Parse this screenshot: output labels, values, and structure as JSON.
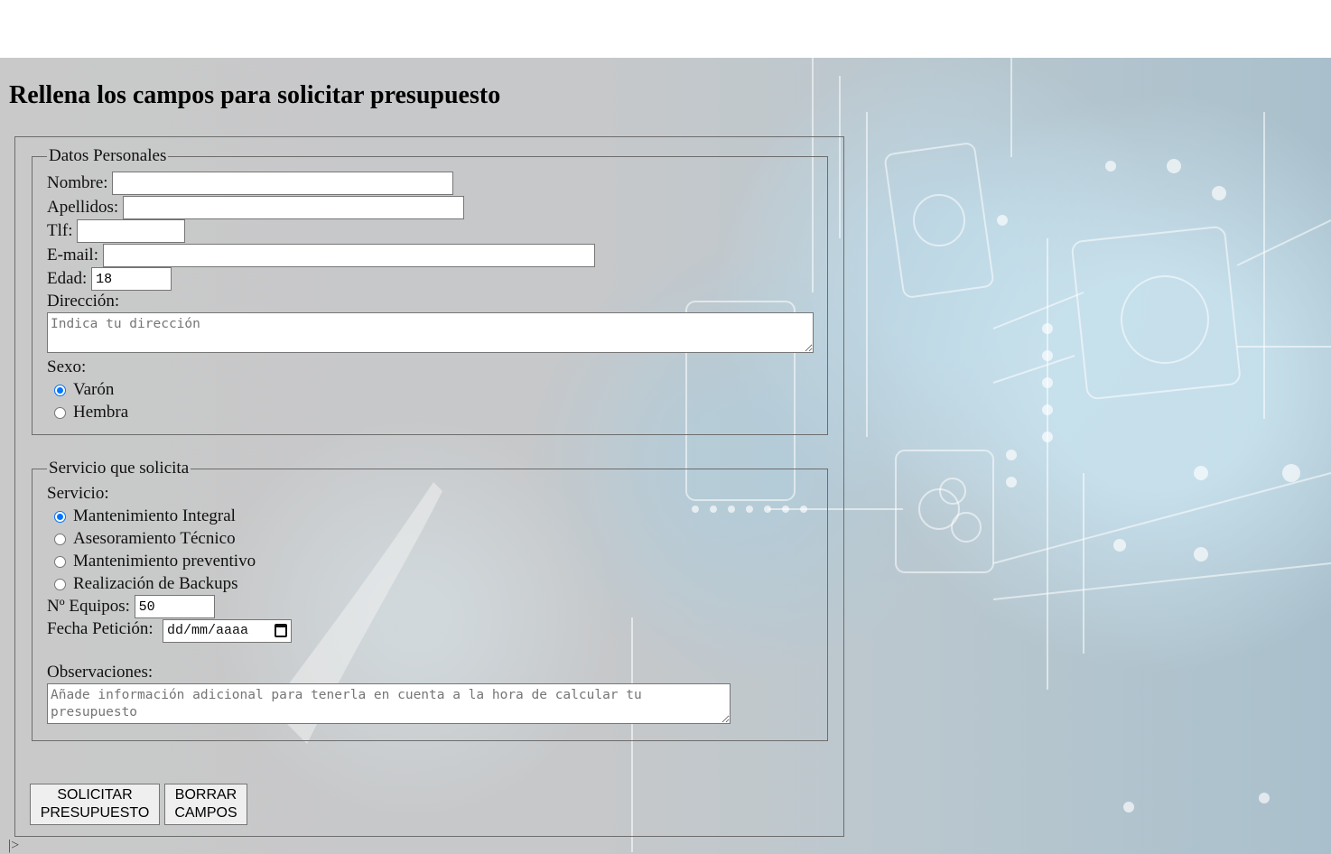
{
  "page": {
    "heading": "Rellena los campos para solicitar presupuesto",
    "stray_text": "|>"
  },
  "personal": {
    "legend": "Datos Personales",
    "nombre_label": "Nombre:",
    "nombre_value": "",
    "apellidos_label": "Apellidos:",
    "apellidos_value": "",
    "tlf_label": "Tlf:",
    "tlf_value": "",
    "email_label": "E-mail:",
    "email_value": "",
    "edad_label": "Edad:",
    "edad_value": "18",
    "direccion_label": "Dirección:",
    "direccion_placeholder": "Indica tu dirección",
    "sexo_label": "Sexo:",
    "sexo_options": [
      {
        "label": "Varón",
        "checked": true
      },
      {
        "label": "Hembra",
        "checked": false
      }
    ]
  },
  "service": {
    "legend": "Servicio que solicita",
    "servicio_label": "Servicio:",
    "options": [
      {
        "label": "Mantenimiento Integral",
        "checked": true
      },
      {
        "label": "Asesoramiento Técnico",
        "checked": false
      },
      {
        "label": "Mantenimiento preventivo",
        "checked": false
      },
      {
        "label": "Realización de Backups",
        "checked": false
      }
    ],
    "equipos_label": "Nº Equipos:",
    "equipos_value": "50",
    "fecha_label": "Fecha Petición:",
    "fecha_placeholder": "dd/mm/aaaa",
    "fecha_icon": "calendar-icon",
    "observaciones_label": "Observaciones:",
    "observaciones_placeholder": "Añade información adicional para tenerla en cuenta a la hora de calcular tu presupuesto"
  },
  "buttons": {
    "submit_line1": "SOLICITAR",
    "submit_line2": "PRESUPUESTO",
    "reset_line1": "BORRAR",
    "reset_line2": "CAMPOS"
  },
  "colors": {
    "radio_accent": "#0075ff",
    "background_tint": "#c6c8ca"
  }
}
